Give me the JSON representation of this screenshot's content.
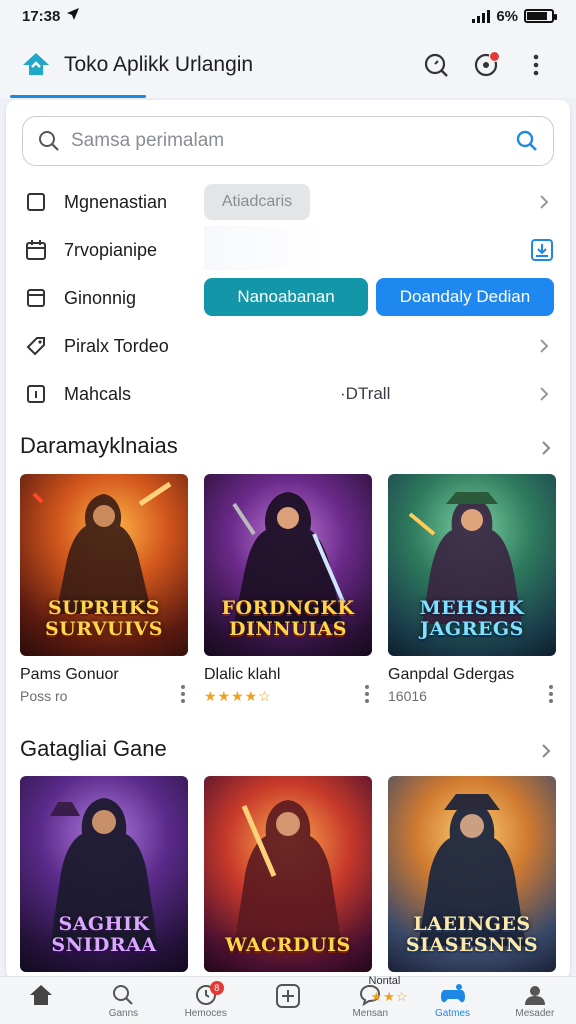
{
  "status": {
    "time": "17:38",
    "battery": "6%",
    "battery_level": 0.85
  },
  "header": {
    "title": "Toko Aplikk Urlangin"
  },
  "search": {
    "placeholder": "Samsa perimalam"
  },
  "menu": {
    "row1": {
      "label": "Mgnenastian",
      "chip": "Atiadcaris"
    },
    "row2": {
      "label": "7rvopianipe"
    },
    "row3": {
      "label": "Ginonnig",
      "button1": "Nanoabanan",
      "button2": "Doandaly Dedian"
    },
    "row4": {
      "label": "Piralx Tordeo"
    },
    "row5": {
      "label": "Mahcals",
      "value": "·DTrall"
    }
  },
  "section1": {
    "title": "Daramayklnaias",
    "tiles": [
      {
        "art_title": "SUPRHKS SURVUIVS",
        "name": "Pams Gonuor",
        "meta": "Poss ro",
        "rating": 0
      },
      {
        "art_title": "FORDNGKK DINNUIAS",
        "name": "Dlalic klahl",
        "meta": "",
        "rating": 4
      },
      {
        "art_title": "MEHSHK JAGREGS",
        "name": "Ganpdal Gdergas",
        "meta": "16016",
        "rating": 0
      }
    ]
  },
  "section2": {
    "title": "Gatagliai Gane",
    "tiles": [
      {
        "art_title": "SAGHIK SNIDRAA"
      },
      {
        "art_title": "WACRDUIS"
      },
      {
        "art_title": "LAEINGES SIASESNNS"
      }
    ]
  },
  "bottom_nav": {
    "items": [
      {
        "label": ""
      },
      {
        "label": "Ganns"
      },
      {
        "label": "Hemoces",
        "badge": "8"
      },
      {
        "label": ""
      },
      {
        "label": "Mensan",
        "floating": "Nontal"
      },
      {
        "label": "Gatmes"
      },
      {
        "label": "Mesader"
      }
    ]
  },
  "colors": {
    "accent": "#1e88e5",
    "teal": "#1496a9",
    "badge": "#e53935"
  }
}
